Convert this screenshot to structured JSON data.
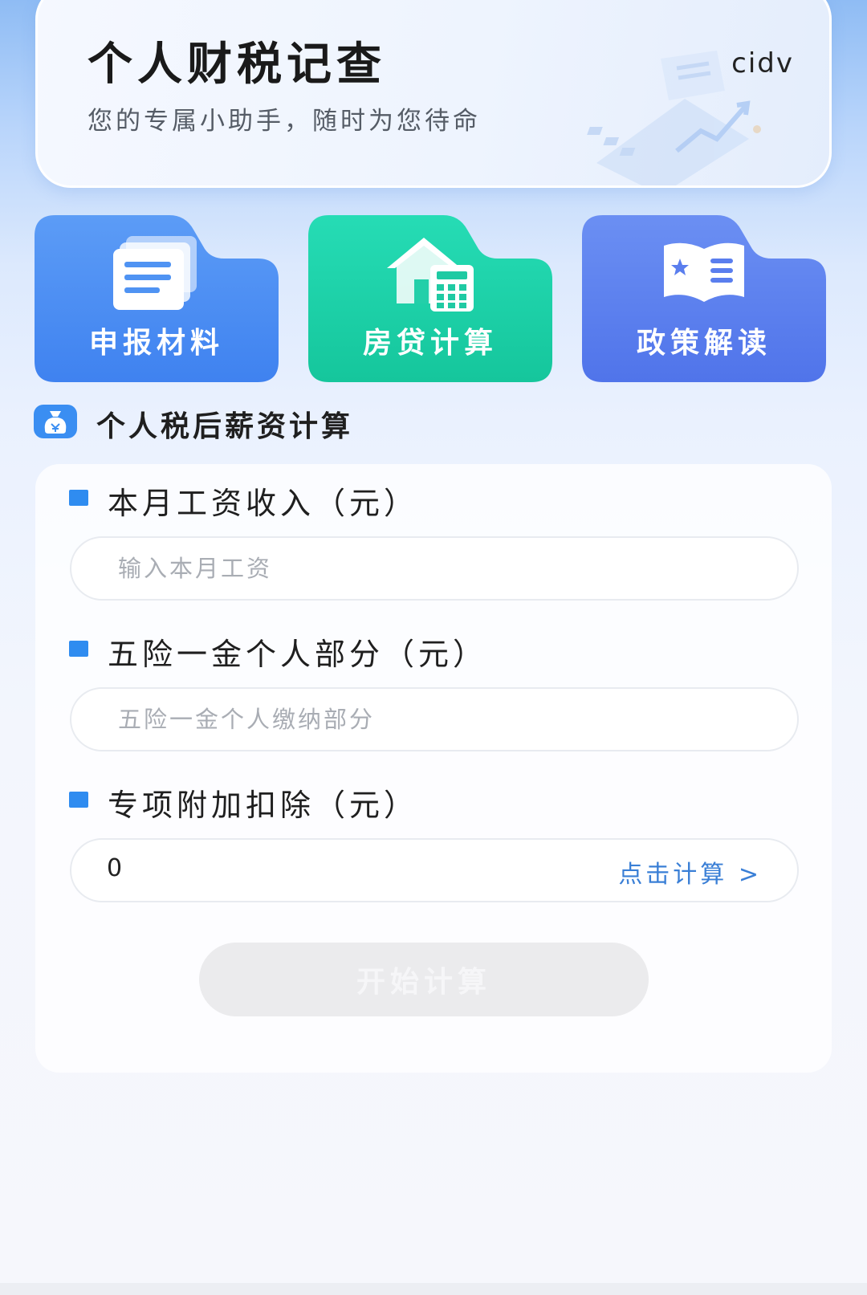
{
  "header": {
    "title": "个人财税记查",
    "subtitle": "您的专属小助手，随时为您待命",
    "version_tag": "cidv",
    "illustration_icon": "chart-document-illustration"
  },
  "tiles": [
    {
      "label": "申报材料",
      "icon": "stacked-documents-icon",
      "color_top": "#5c9cf6",
      "color_bottom": "#3f82f0"
    },
    {
      "label": "房贷计算",
      "icon": "house-calculator-icon",
      "color_top": "#26dcb5",
      "color_bottom": "#15c69c"
    },
    {
      "label": "政策解读",
      "icon": "open-book-star-icon",
      "color_top": "#6b8ff3",
      "color_bottom": "#5074ea"
    }
  ],
  "section": {
    "title": "个人税后薪资计算",
    "icon": "money-bag-icon"
  },
  "form": {
    "salary": {
      "label": "本月工资收入（元）",
      "placeholder": "输入本月工资",
      "value": ""
    },
    "insurance": {
      "label": "五险一金个人部分（元）",
      "placeholder": "五险一金个人缴纳部分",
      "value": ""
    },
    "deduction": {
      "label": "专项附加扣除（元）",
      "value": "0",
      "action_label": "点击计算 >"
    },
    "submit_label": "开始计算"
  },
  "colors": {
    "accent": "#2f8cf0",
    "link": "#3a7fd6",
    "disabled_button": "#ebebed"
  }
}
